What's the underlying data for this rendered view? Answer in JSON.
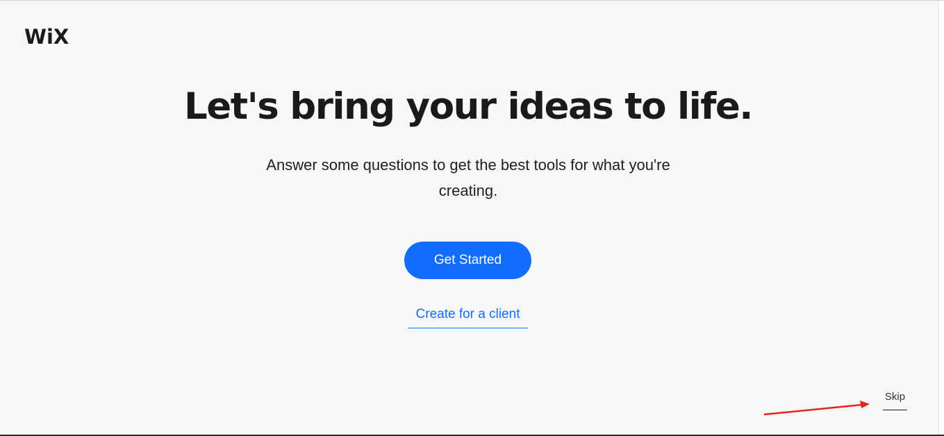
{
  "header": {
    "logo_text": "WiX"
  },
  "hero": {
    "headline": "Let's bring your ideas to life.",
    "subtitle": "Answer some questions to get the best tools for what you're creating."
  },
  "actions": {
    "get_started_label": "Get Started",
    "create_for_client_label": "Create for a client",
    "skip_label": "Skip"
  },
  "annotation": {
    "arrow_color": "#e8211d",
    "arrow_target": "skip-link"
  },
  "colors": {
    "accent": "#116dff",
    "background": "#f6f7f9",
    "text": "#1a1a1a"
  }
}
